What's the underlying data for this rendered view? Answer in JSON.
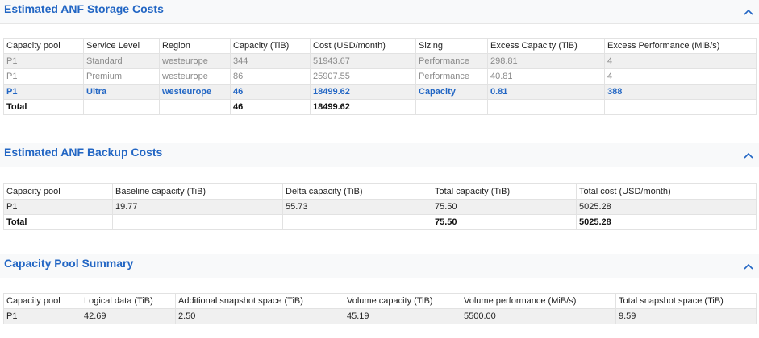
{
  "storage": {
    "title": "Estimated ANF Storage Costs",
    "columns": [
      "Capacity pool",
      "Service Level",
      "Region",
      "Capacity (TiB)",
      "Cost (USD/month)",
      "Sizing",
      "Excess Capacity (TiB)",
      "Excess Performance (MiB/s)"
    ],
    "rows": [
      [
        "P1",
        "Standard",
        "westeurope",
        "344",
        "51943.67",
        "Performance",
        "298.81",
        "4"
      ],
      [
        "P1",
        "Premium",
        "westeurope",
        "86",
        "25907.55",
        "Performance",
        "40.81",
        "4"
      ],
      [
        "P1",
        "Ultra",
        "westeurope",
        "46",
        "18499.62",
        "Capacity",
        "0.81",
        "388"
      ]
    ],
    "total": [
      "Total",
      "",
      "",
      "46",
      "18499.62",
      "",
      "",
      ""
    ]
  },
  "backup": {
    "title": "Estimated ANF Backup Costs",
    "columns": [
      "Capacity pool",
      "Baseline capacity (TiB)",
      "Delta capacity (TiB)",
      "Total capacity (TiB)",
      "Total cost (USD/month)"
    ],
    "rows": [
      [
        "P1",
        "19.77",
        "55.73",
        "75.50",
        "5025.28"
      ]
    ],
    "total": [
      "Total",
      "",
      "",
      "75.50",
      "5025.28"
    ]
  },
  "summary": {
    "title": "Capacity Pool Summary",
    "columns": [
      "Capacity pool",
      "Logical data (TiB)",
      "Additional snapshot space (TiB)",
      "Volume capacity (TiB)",
      "Volume performance (MiB/s)",
      "Total snapshot space (TiB)"
    ],
    "rows": [
      [
        "P1",
        "42.69",
        "2.50",
        "45.19",
        "5500.00",
        "9.59"
      ]
    ]
  },
  "icons": {
    "collapse": "chevron-up-icon"
  },
  "colors": {
    "accent": "#2266c4",
    "row_grey": "#f0f0f0",
    "muted_text": "#8a8a8a"
  }
}
